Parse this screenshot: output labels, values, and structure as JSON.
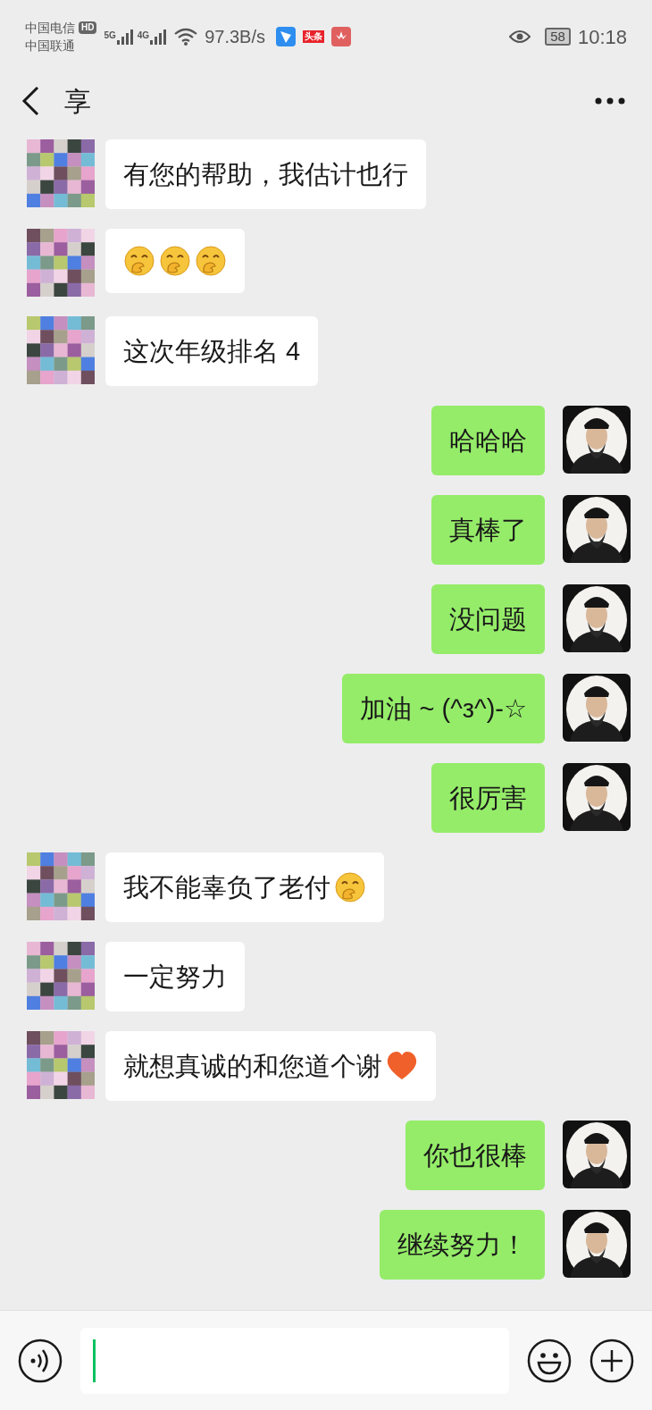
{
  "status_bar": {
    "carrier_1": "中国电信",
    "hd_badge": "HD",
    "carrier_2": "中国联通",
    "net_1": "5G",
    "net_2": "4G",
    "speed": "97.3B/s",
    "app_badge": "头条",
    "battery": "58",
    "time": "10:18"
  },
  "header": {
    "title": "享"
  },
  "messages": [
    {
      "kind": "received",
      "text": "有您的帮助，我估计也行"
    },
    {
      "kind": "received",
      "emojis": [
        {
          "kind": "giggle"
        },
        {
          "kind": "giggle"
        },
        {
          "kind": "giggle"
        }
      ]
    },
    {
      "kind": "received",
      "text": "这次年级排名 4"
    },
    {
      "kind": "sent",
      "text": "哈哈哈"
    },
    {
      "kind": "sent",
      "text": "真棒了"
    },
    {
      "kind": "sent",
      "text": "没问题"
    },
    {
      "kind": "sent",
      "text": "加油 ~ (^з^)-☆"
    },
    {
      "kind": "sent",
      "text": "很厉害"
    },
    {
      "kind": "received",
      "text": "我不能辜负了老付",
      "emojis": [
        {
          "kind": "giggle"
        }
      ]
    },
    {
      "kind": "received",
      "text": "一定努力"
    },
    {
      "kind": "received",
      "text": "就想真诚的和您道个谢",
      "emojis": [
        {
          "kind": "heart"
        }
      ]
    },
    {
      "kind": "sent",
      "text": "你也很棒"
    },
    {
      "kind": "sent",
      "text": "继续努力！"
    }
  ]
}
